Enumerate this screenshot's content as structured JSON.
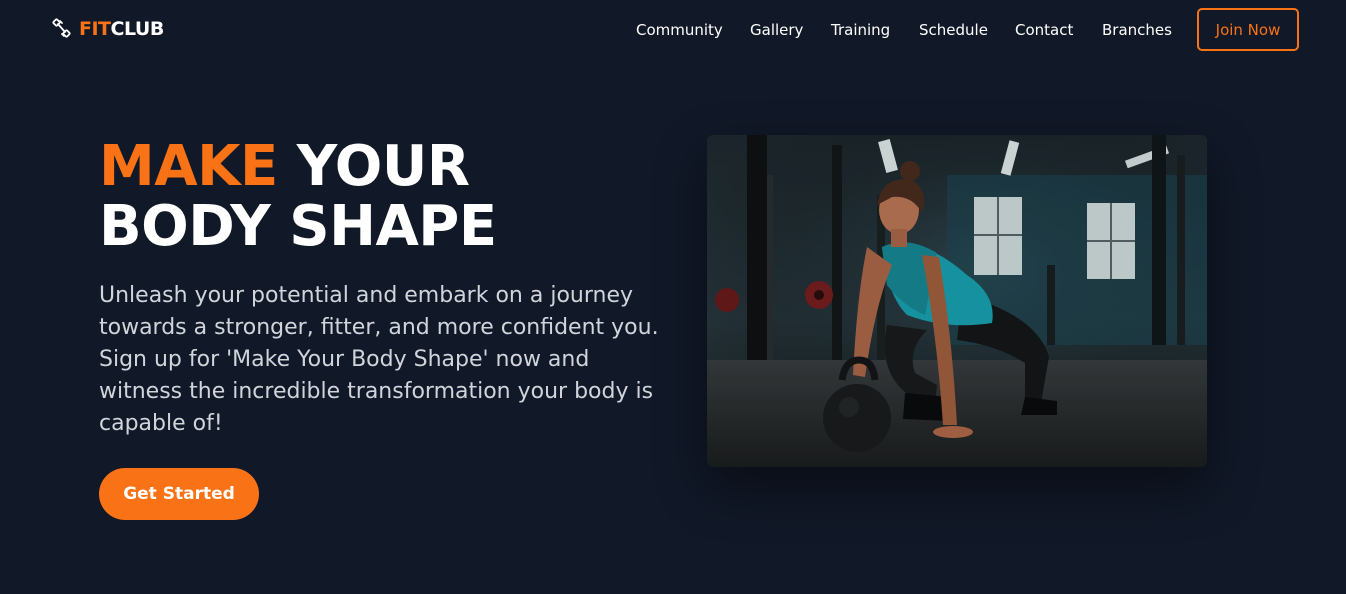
{
  "brand": {
    "part1": "FIT",
    "part2": "CLUB"
  },
  "nav": {
    "links": [
      "Community",
      "Gallery",
      "Training",
      "Schedule",
      "Contact",
      "Branches"
    ],
    "join_label": "Join Now"
  },
  "hero": {
    "headline_accent": "MAKE",
    "headline_rest_line1": " YOUR",
    "headline_line2": "BODY SHAPE",
    "description": "Unleash your potential and embark on a journey towards a stronger, fitter, and more confident you. Sign up for 'Make Your Body Shape' now and witness the incredible transformation your body is capable of!",
    "cta_label": "Get Started",
    "image_icon": "gym-woman-kettlebell-photo"
  },
  "colors": {
    "background": "#111827",
    "accent": "#f97316",
    "text": "#ffffff",
    "muted_text": "#d1d5db"
  }
}
